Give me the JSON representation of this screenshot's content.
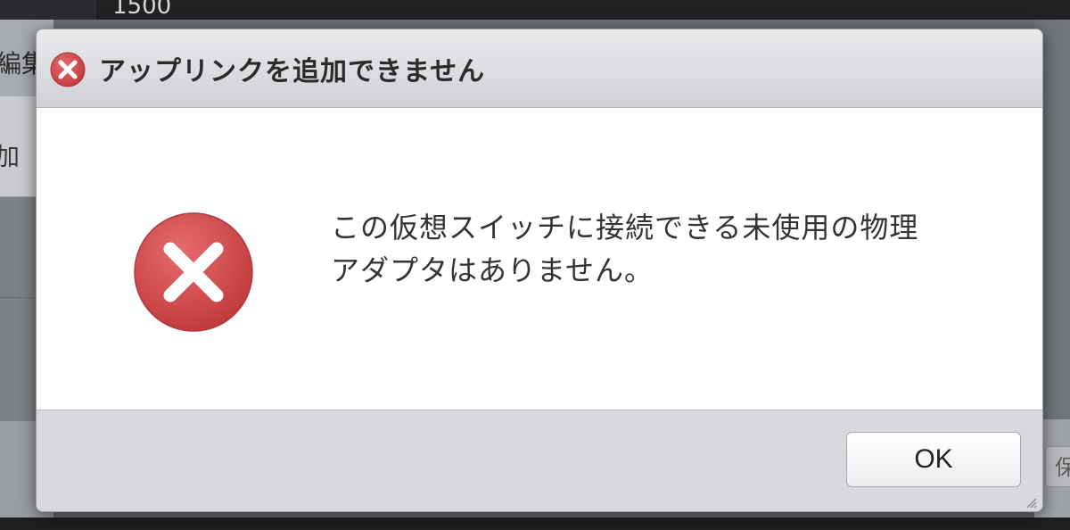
{
  "background": {
    "top_number": "1500",
    "edit_label": "編集",
    "add_label": "加",
    "save_button_partial": "保"
  },
  "dialog": {
    "title": "アップリンクを追加できません",
    "title_icon": "error-icon",
    "message_line1": "この仮想スイッチに接続できる未使用の物理",
    "message_line2": "アダプタはありません。",
    "body_icon": "error-icon",
    "ok_label": "OK",
    "grip_icon": "resize-grip-icon"
  },
  "colors": {
    "error_red": "#d2474a",
    "titlebar": "#dcdee1",
    "footer": "#d7d9de"
  }
}
